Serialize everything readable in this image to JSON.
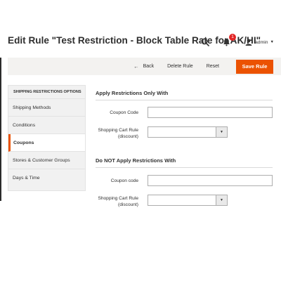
{
  "header": {
    "title": "Edit Rule \"Test Restriction - Block Table Rate for AK/HI\"",
    "notification_count": "1",
    "user_name": "admin"
  },
  "actions": {
    "back": "Back",
    "delete": "Delete Rule",
    "reset": "Reset",
    "save": "Save Rule"
  },
  "sidebar": {
    "title": "SHIPPING RESTRICTIONS OPTIONS",
    "items": [
      {
        "label": "Shipping Methods",
        "active": false
      },
      {
        "label": "Conditions",
        "active": false
      },
      {
        "label": "Coupons",
        "active": true
      },
      {
        "label": "Stores & Customer Groups",
        "active": false
      },
      {
        "label": "Days & Time",
        "active": false
      }
    ]
  },
  "apply_section": {
    "title": "Apply Restrictions Only With",
    "coupon_code_label": "Coupon Code",
    "coupon_code_value": "",
    "cart_rule_label_1": "Shopping Cart Rule",
    "cart_rule_label_2": "(discount)",
    "cart_rule_value": ""
  },
  "not_apply_section": {
    "title": "Do NOT Apply Restrictions With",
    "coupon_code_label": "Coupon code",
    "coupon_code_value": "",
    "cart_rule_label_1": "Shopping Cart Rule",
    "cart_rule_label_2": "(discount)",
    "cart_rule_value": ""
  },
  "colors": {
    "accent": "#eb5202",
    "badge": "#e22626",
    "action_bar": "#f3f2f0",
    "sidebar_bg": "#f1f1f1"
  },
  "icons": {
    "search": "search-icon",
    "notifications": "bell-icon",
    "user": "user-icon",
    "back": "arrow-left-icon",
    "dropdown": "caret-down-icon"
  }
}
